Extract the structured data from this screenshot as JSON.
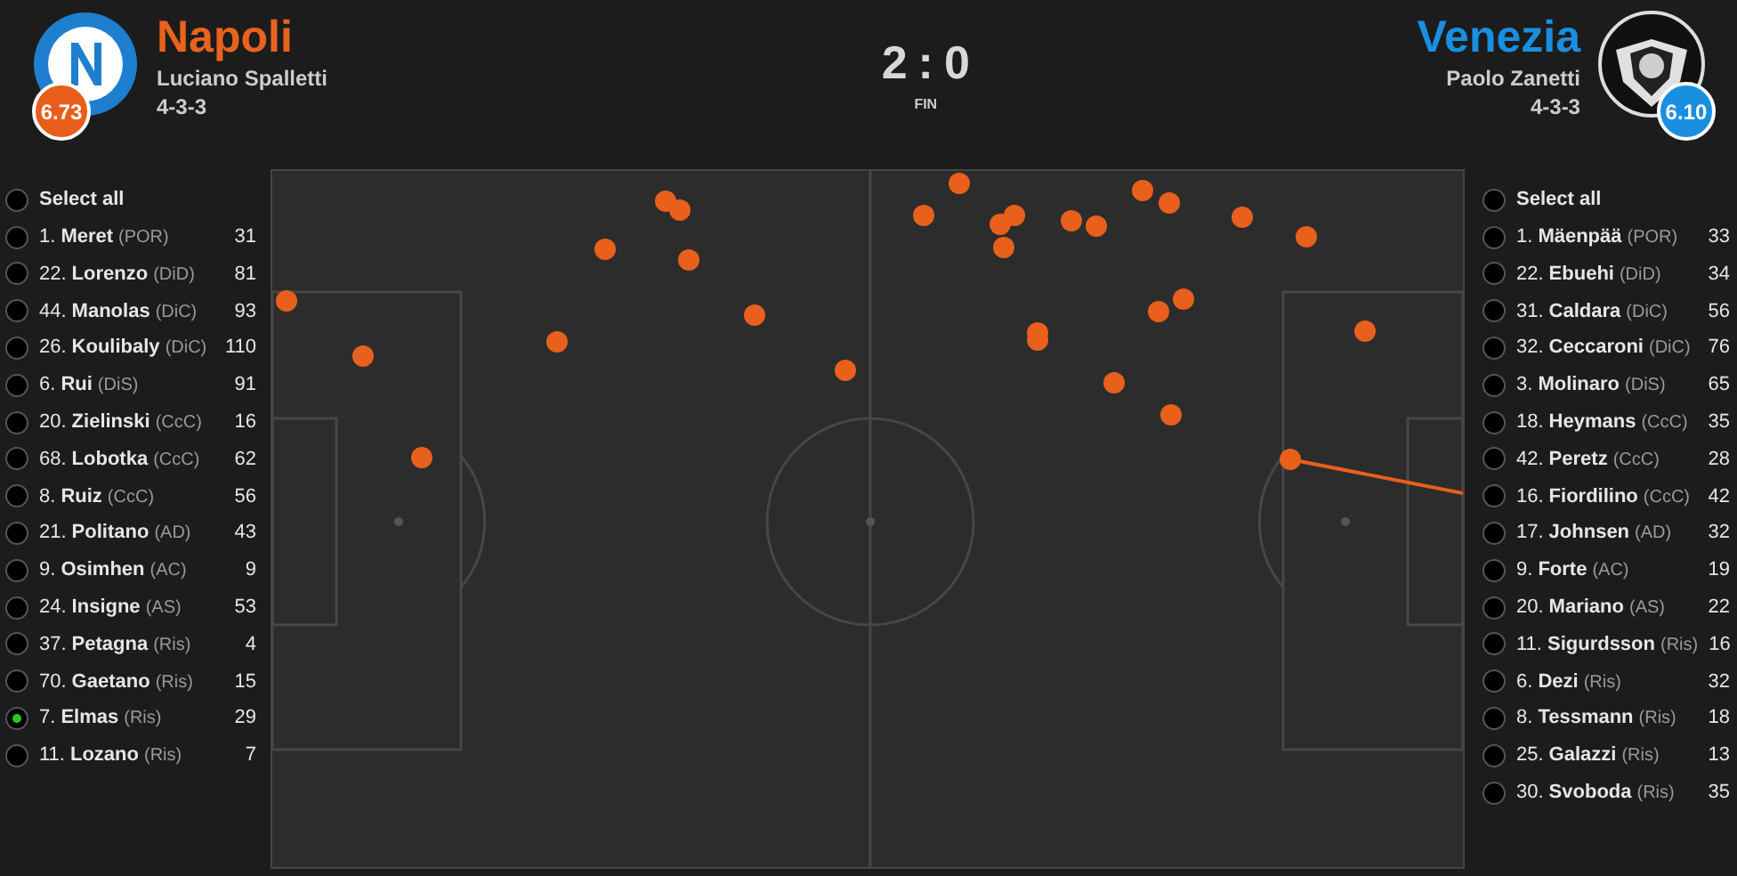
{
  "home": {
    "name": "Napoli",
    "coach": "Luciano Spalletti",
    "formation": "4-3-3",
    "rating": "6.73"
  },
  "away": {
    "name": "Venezia",
    "coach": "Paolo Zanetti",
    "formation": "4-3-3",
    "rating": "6.10"
  },
  "score": {
    "home": "2",
    "separator": ":",
    "away": "0",
    "status": "FIN"
  },
  "home_players": {
    "select_all": {
      "label": "Select all",
      "selected": false
    },
    "players": [
      {
        "number": "1.",
        "name": "Meret",
        "position": "(POR)",
        "count": "31",
        "selected": false
      },
      {
        "number": "22.",
        "name": "Lorenzo",
        "position": "(DiD)",
        "count": "81",
        "selected": false
      },
      {
        "number": "44.",
        "name": "Manolas",
        "position": "(DiC)",
        "count": "93",
        "selected": false
      },
      {
        "number": "26.",
        "name": "Koulibaly",
        "position": "(DiC)",
        "count": "110",
        "selected": false
      },
      {
        "number": "6.",
        "name": "Rui",
        "position": "(DiS)",
        "count": "91",
        "selected": false
      },
      {
        "number": "20.",
        "name": "Zielinski",
        "position": "(CcC)",
        "count": "16",
        "selected": false
      },
      {
        "number": "68.",
        "name": "Lobotka",
        "position": "(CcC)",
        "count": "62",
        "selected": false
      },
      {
        "number": "8.",
        "name": "Ruiz",
        "position": "(CcC)",
        "count": "56",
        "selected": false
      },
      {
        "number": "21.",
        "name": "Politano",
        "position": "(AD)",
        "count": "43",
        "selected": false
      },
      {
        "number": "9.",
        "name": "Osimhen",
        "position": "(AC)",
        "count": "9",
        "selected": false
      },
      {
        "number": "24.",
        "name": "Insigne",
        "position": "(AS)",
        "count": "53",
        "selected": false
      },
      {
        "number": "37.",
        "name": "Petagna",
        "position": "(Ris)",
        "count": "4",
        "selected": false
      },
      {
        "number": "70.",
        "name": "Gaetano",
        "position": "(Ris)",
        "count": "15",
        "selected": false
      },
      {
        "number": "7.",
        "name": "Elmas",
        "position": "(Ris)",
        "count": "29",
        "selected": true
      },
      {
        "number": "11.",
        "name": "Lozano",
        "position": "(Ris)",
        "count": "7",
        "selected": false
      }
    ]
  },
  "away_players": {
    "select_all": {
      "label": "Select all",
      "selected": false
    },
    "players": [
      {
        "number": "1.",
        "name": "Mäenpää",
        "position": "(POR)",
        "count": "33",
        "selected": false
      },
      {
        "number": "22.",
        "name": "Ebuehi",
        "position": "(DiD)",
        "count": "34",
        "selected": false
      },
      {
        "number": "31.",
        "name": "Caldara",
        "position": "(DiC)",
        "count": "56",
        "selected": false
      },
      {
        "number": "32.",
        "name": "Ceccaroni",
        "position": "(DiC)",
        "count": "76",
        "selected": false
      },
      {
        "number": "3.",
        "name": "Molinaro",
        "position": "(DiS)",
        "count": "65",
        "selected": false
      },
      {
        "number": "18.",
        "name": "Heymans",
        "position": "(CcC)",
        "count": "35",
        "selected": false
      },
      {
        "number": "42.",
        "name": "Peretz",
        "position": "(CcC)",
        "count": "28",
        "selected": false
      },
      {
        "number": "16.",
        "name": "Fiordilino",
        "position": "(CcC)",
        "count": "42",
        "selected": false
      },
      {
        "number": "17.",
        "name": "Johnsen",
        "position": "(AD)",
        "count": "32",
        "selected": false
      },
      {
        "number": "9.",
        "name": "Forte",
        "position": "(AC)",
        "count": "19",
        "selected": false
      },
      {
        "number": "20.",
        "name": "Mariano",
        "position": "(AS)",
        "count": "22",
        "selected": false
      },
      {
        "number": "11.",
        "name": "Sigurdsson",
        "position": "(Ris)",
        "count": "16",
        "selected": false
      },
      {
        "number": "6.",
        "name": "Dezi",
        "position": "(Ris)",
        "count": "32",
        "selected": false
      },
      {
        "number": "8.",
        "name": "Tessmann",
        "position": "(Ris)",
        "count": "18",
        "selected": false
      },
      {
        "number": "25.",
        "name": "Galazzi",
        "position": "(Ris)",
        "count": "13",
        "selected": false
      },
      {
        "number": "30.",
        "name": "Svoboda",
        "position": "(Ris)",
        "count": "35",
        "selected": false
      }
    ]
  }
}
